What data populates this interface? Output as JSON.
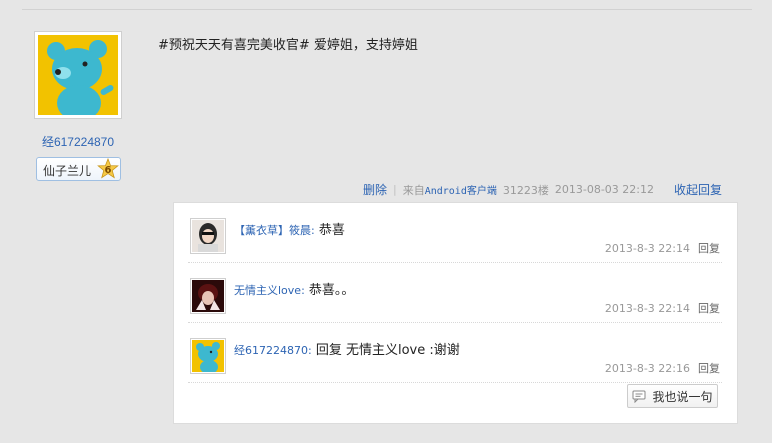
{
  "post": {
    "author_name": "经617224870",
    "badge_name": "仙子兰儿",
    "badge_level": "6",
    "content": "#预祝天天有喜完美收官# 爱婷姐，支持婷姐",
    "delete_label": "删除",
    "source_prefix": "来自",
    "source_client": "Android客户端",
    "floor": "31223楼",
    "timestamp": "2013-08-03 22:12",
    "fold_label": "收起回复"
  },
  "replies": [
    {
      "name": "【薰衣草】筱晨:",
      "text": " 恭喜",
      "time": "2013-8-3 22:14",
      "reply_label": "回复"
    },
    {
      "name": "无情主义love:",
      "text": " 恭喜。。",
      "time": "2013-8-3 22:14",
      "reply_label": "回复"
    },
    {
      "name": "经617224870:",
      "text": " 回复 无情主义love :谢谢",
      "time": "2013-8-3 22:16",
      "reply_label": "回复"
    }
  ],
  "say_button_label": "我也说一句",
  "colors": {
    "link": "#2d64b3",
    "muted": "#999999",
    "background": "#e6e6e6"
  }
}
